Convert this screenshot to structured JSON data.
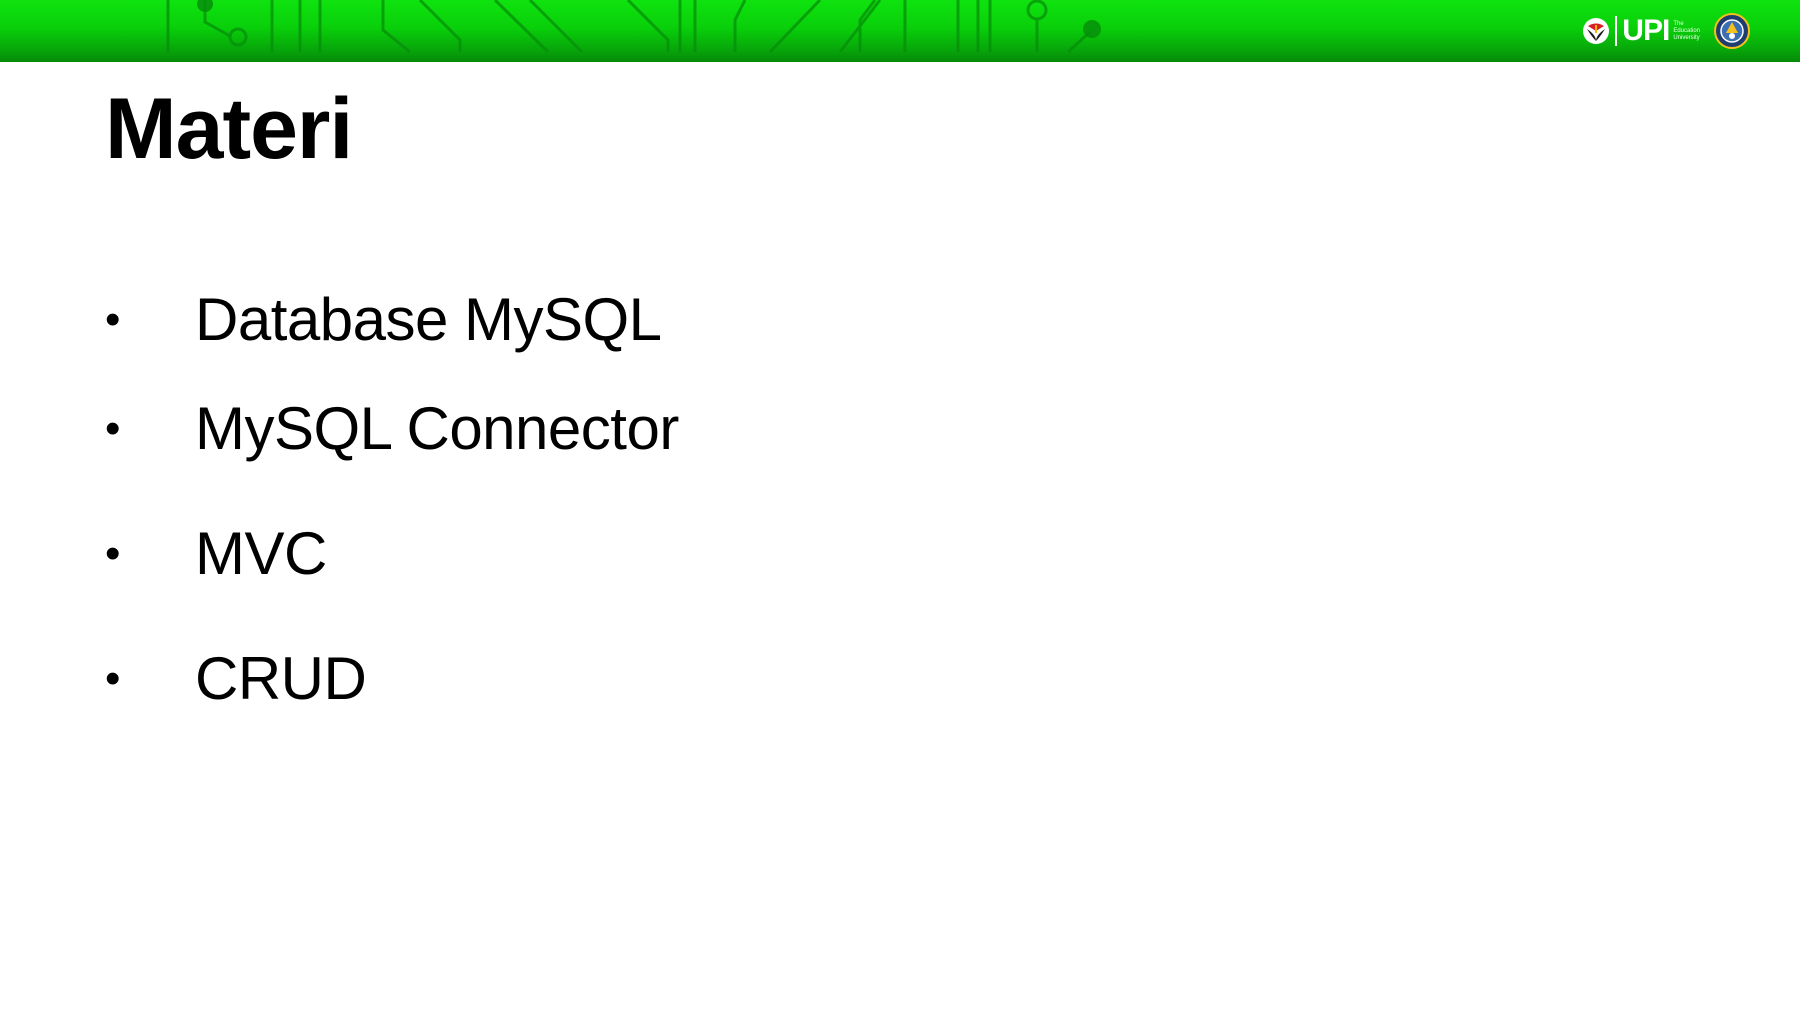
{
  "slide": {
    "title": "Materi",
    "bullet_symbol": "•",
    "items": [
      {
        "label": "Database MySQL"
      },
      {
        "label": "MySQL Connector"
      },
      {
        "label": "MVC"
      },
      {
        "label": "CRUD"
      }
    ]
  },
  "header": {
    "logo_text": "UPI",
    "logo_tagline": [
      "The",
      "Education",
      "University"
    ],
    "icons": [
      "upi-emblem-icon",
      "upi-logo",
      "institution-seal-icon"
    ]
  },
  "colors": {
    "banner_green": "#0bd80c",
    "banner_dark": "#068a08",
    "text": "#000000",
    "background": "#ffffff"
  }
}
